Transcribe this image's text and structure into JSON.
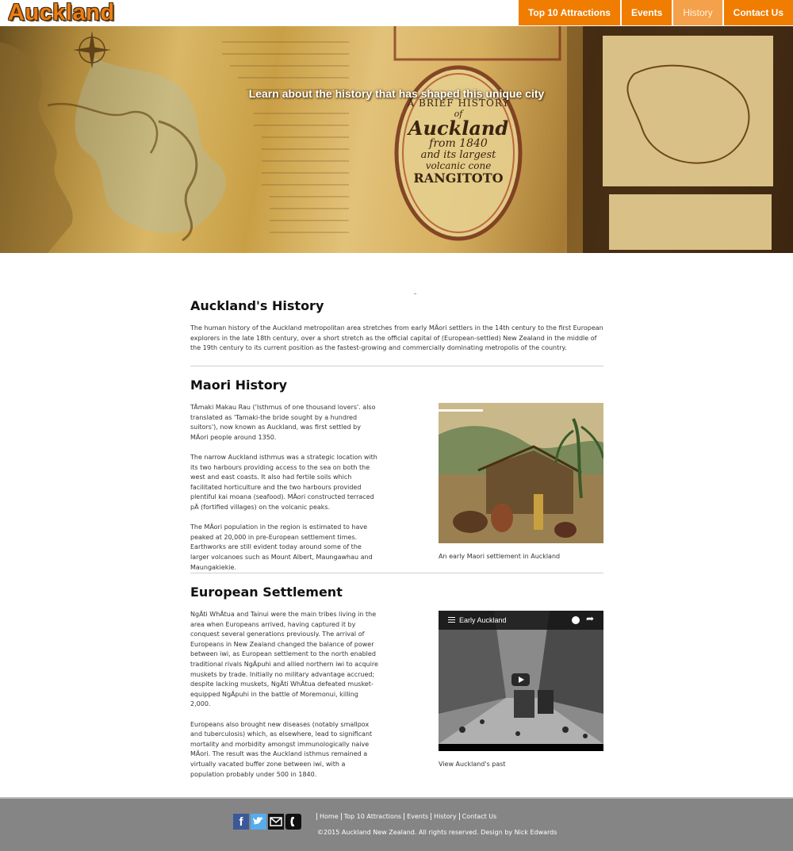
{
  "header": {
    "logo": "Auckland",
    "nav": [
      {
        "label": "Top 10 Attractions"
      },
      {
        "label": "Events"
      },
      {
        "label": "History"
      },
      {
        "label": "Contact Us"
      }
    ]
  },
  "hero": {
    "tagline": "Learn about the history that has shaped this unique city",
    "image_text": {
      "line1": "A BRIEF HISTORY",
      "line2": "of",
      "line3": "Auckland",
      "line4": "from 1840",
      "line5": "and its largest",
      "line6": "volcanic cone",
      "line7": "RANGITOTO"
    }
  },
  "main": {
    "history_title": "Auckland's History",
    "history_text": "The human history of the Auckland metropolitan area stretches from early MÄori settlers in the 14th century to the first European explorers in the late 18th century, over a short stretch as the official capital of (European-settled) New Zealand in the middle of the 19th century to its current position as the fastest-growing and commercially dominating metropolis of the country.",
    "maori": {
      "title": "Maori History",
      "paragraphs": [
        "TÄmaki Makau Rau ('Isthmus of one thousand lovers'. also translated as 'Tamaki-the bride sought by a hundred suitors'), now known as Auckland, was first settled by MÄori people around 1350.",
        "The narrow Auckland isthmus was a strategic location with its two harbours providing access to the sea on both the west and east coasts. It also had fertile soils which facilitated horticulture and the two harbours provided plentiful kai moana (seafood). MÄori constructed terraced pÄ (fortified villages) on the volcanic peaks.",
        "The MÄori population in the region is estimated to have peaked at 20,000 in pre-European settlement times. Earthworks are still evident today around some of the larger volcanoes such as Mount Albert, Maungawhau and Maungakiekie."
      ],
      "caption": "An early Maori settlement in Auckland"
    },
    "european": {
      "title": "European Settlement",
      "paragraphs": [
        "NgÄti WhÄtua and Tainui were the main tribes living in the area when Europeans arrived, having captured it by conquest several generations previously. The arrival of Europeans in New Zealand changed the balance of power between iwi, as European settlement to the north enabled traditional rivals NgÄpuhi and allied northern iwi to acquire muskets by trade. Initially no military advantage accrued; despite lacking muskets, NgÄti WhÄtua defeated musket-equipped NgÄpuhi in the battle of Moremonui, killing 2,000.",
        "Europeans also brought new diseases (notably smallpox and tuberculosis) which, as elsewhere, lead to significant mortality and morbidity amongst immunologically naive MÄori. The result was the Auckland isthmus remained a virtually vacated buffer zone between iwi, with a population probably under 500 in 1840."
      ],
      "video_title": "Early Auckland",
      "caption": "View Auckland's past"
    }
  },
  "footer": {
    "links": [
      "Home",
      "Top 10 Attractions",
      "Events",
      "History",
      "Contact Us"
    ],
    "copyright": "©2015 Auckland New Zealand. All rights reserved. Design by Nick Edwards",
    "social_icons": [
      "facebook-icon",
      "twitter-icon",
      "mail-icon",
      "phone-icon"
    ]
  },
  "colors": {
    "accent": "#f07d00",
    "nav_active": "#f5a04a",
    "footer_bg": "#858585"
  }
}
